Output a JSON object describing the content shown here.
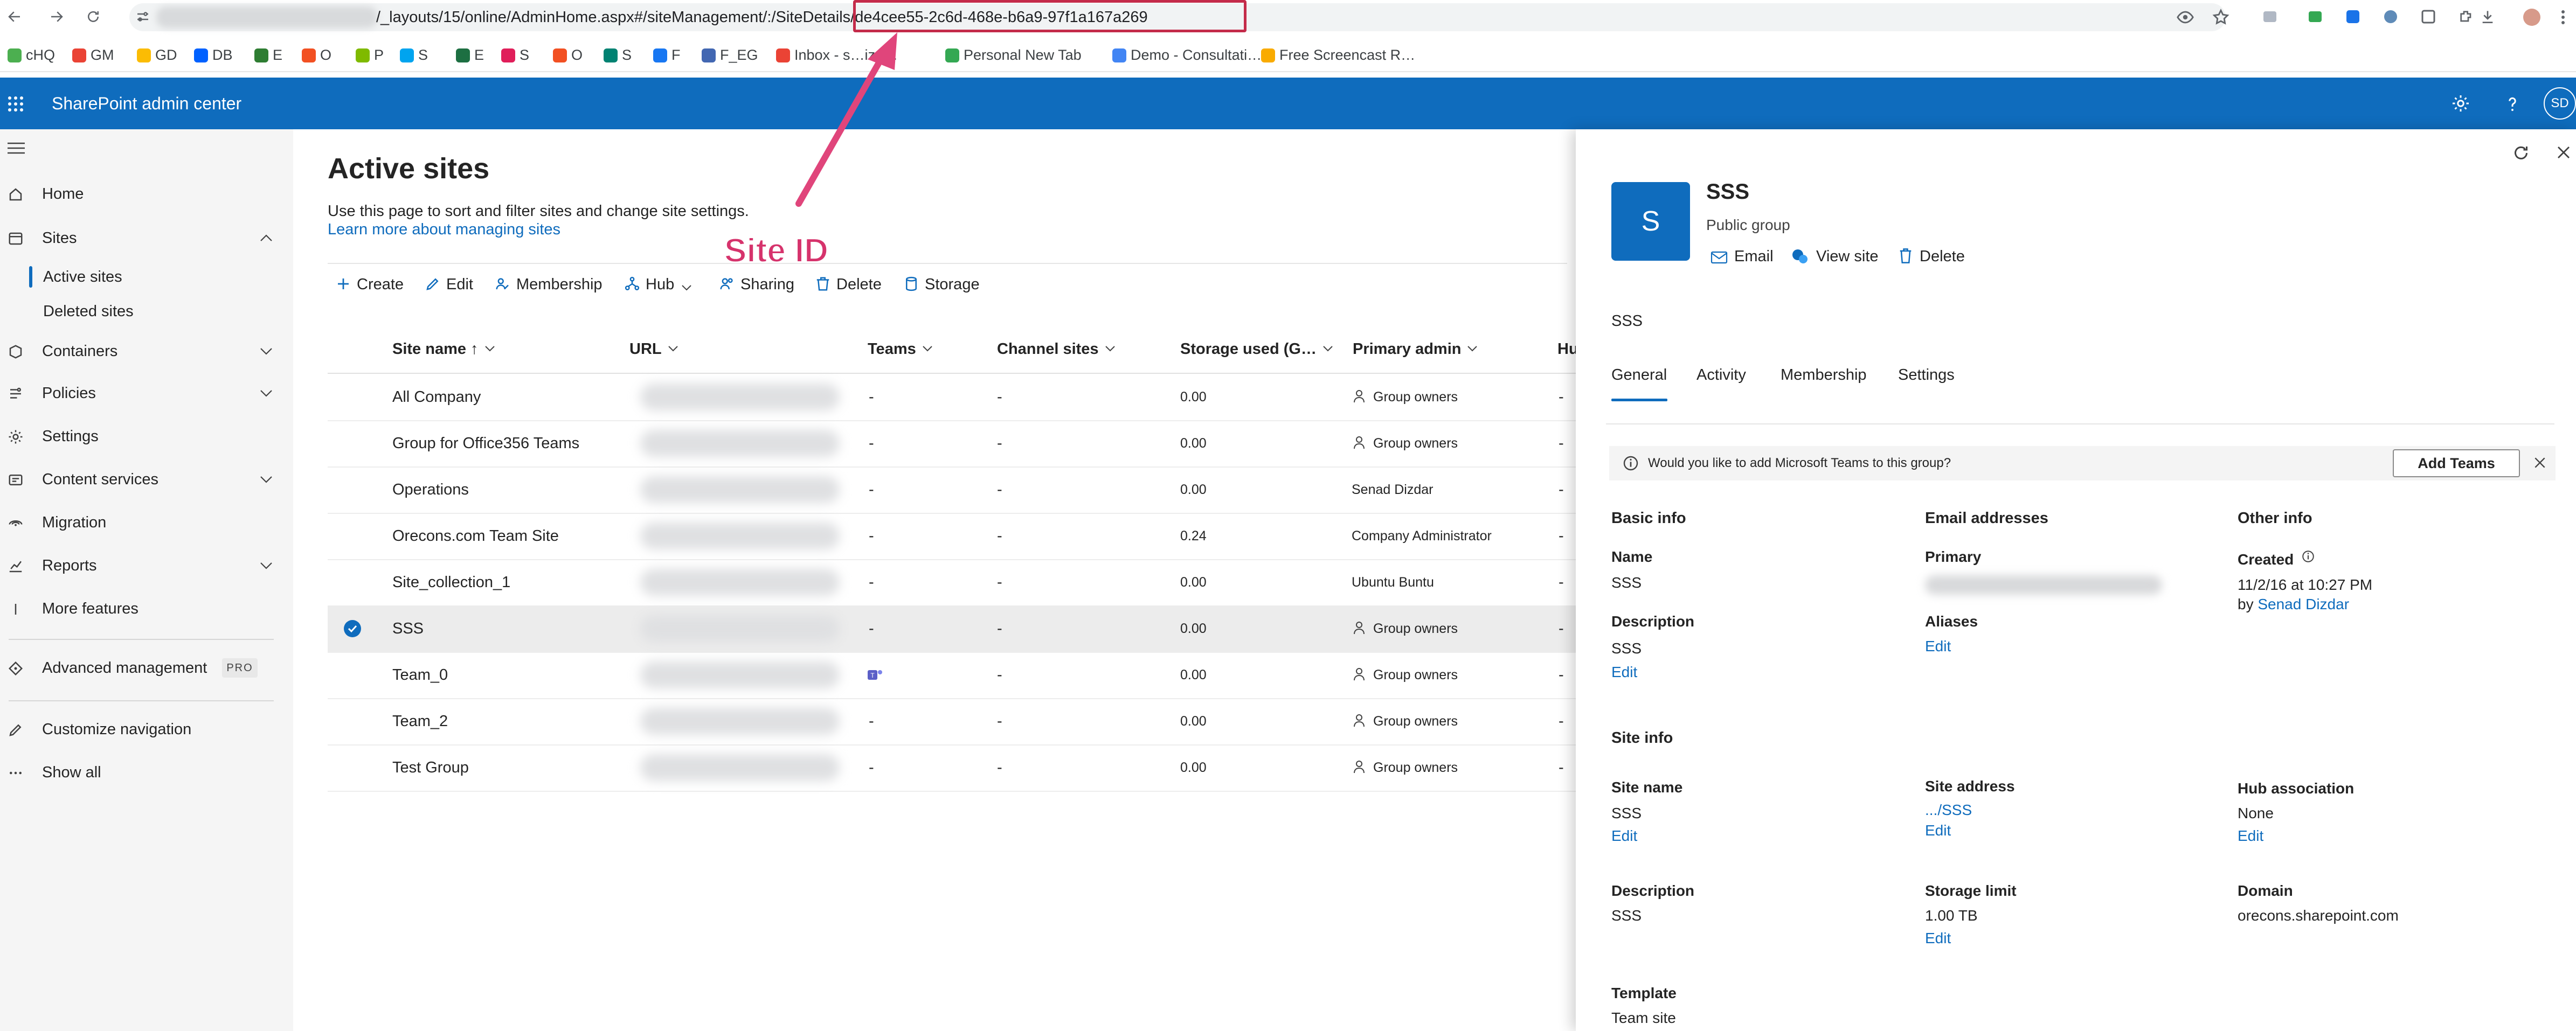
{
  "browser": {
    "url_visible": "/_layouts/15/online/AdminHome.aspx#/siteManagement/:/SiteDetails/de4cee55-2c6d-468e-b6a9-97f1a167a269",
    "bookmarks": [
      {
        "label": "cHQ",
        "color": "#4caf50"
      },
      {
        "label": "GM",
        "color": "#ea4335"
      },
      {
        "label": "GD",
        "color": "#fbbc04"
      },
      {
        "label": "DB",
        "color": "#0061ff"
      },
      {
        "label": "E",
        "color": "#2e7d32"
      },
      {
        "label": "O",
        "color": "#f25022"
      },
      {
        "label": "P",
        "color": "#7fba00"
      },
      {
        "label": "S",
        "color": "#00a4ef"
      },
      {
        "label": "E",
        "color": "#1d6f42"
      },
      {
        "label": "S",
        "color": "#e01e5a"
      },
      {
        "label": "O",
        "color": "#f25022"
      },
      {
        "label": "S",
        "color": "#008272"
      },
      {
        "label": "F",
        "color": "#1877f2"
      },
      {
        "label": "F_EG",
        "color": "#4267b2"
      },
      {
        "label": "Inbox - s…izd…",
        "color": "#ea4335"
      },
      {
        "label": "Personal New Tab",
        "color": "#34a853"
      },
      {
        "label": "Demo - Consultati…",
        "color": "#4285f4"
      },
      {
        "label": "Free Screencast R…",
        "color": "#f9ab00"
      }
    ]
  },
  "suite": {
    "title": "SharePoint admin center",
    "avatar": "SD"
  },
  "nav": {
    "items": [
      {
        "label": "Home",
        "icon": "home-icon"
      },
      {
        "label": "Sites",
        "icon": "sites-icon"
      },
      {
        "label": "Containers",
        "icon": "containers-icon"
      },
      {
        "label": "Policies",
        "icon": "policies-icon"
      },
      {
        "label": "Settings",
        "icon": "gear-icon"
      },
      {
        "label": "Content services",
        "icon": "content-services-icon"
      },
      {
        "label": "Migration",
        "icon": "migration-icon"
      },
      {
        "label": "Reports",
        "icon": "reports-icon"
      },
      {
        "label": "More features",
        "icon": "more-features-icon"
      },
      {
        "label": "Advanced management",
        "icon": "advanced-management-icon"
      },
      {
        "label": "Customize navigation",
        "icon": "pencil-icon"
      },
      {
        "label": "Show all",
        "icon": "ellipsis-icon"
      }
    ],
    "sites_sub": [
      "Active sites",
      "Deleted sites"
    ],
    "pro_badge": "PRO",
    "accent": "#0f6cbd"
  },
  "main": {
    "title": "Active sites",
    "description": "Use this page to sort and filter sites and change site settings.",
    "learn_link": "Learn more about managing sites",
    "annotation": "Site ID",
    "toolbar": [
      "Create",
      "Edit",
      "Membership",
      "Hub",
      "Sharing",
      "Delete",
      "Storage"
    ],
    "columns": [
      "Site name ↑",
      "URL",
      "Teams",
      "Channel sites",
      "Storage used (G…",
      "Primary admin",
      "Hu"
    ],
    "rows": [
      {
        "name": "All Company",
        "teams": "-",
        "channel": "-",
        "storage": "0.00",
        "admin": "Group owners",
        "admin_icon": true,
        "hub": "-",
        "selected": false
      },
      {
        "name": "Group for Office356 Teams",
        "teams": "-",
        "channel": "-",
        "storage": "0.00",
        "admin": "Group owners",
        "admin_icon": true,
        "hub": "-",
        "selected": false
      },
      {
        "name": "Operations",
        "teams": "-",
        "channel": "-",
        "storage": "0.00",
        "admin": "Senad Dizdar",
        "admin_icon": false,
        "hub": "-",
        "selected": false
      },
      {
        "name": "Orecons.com Team Site",
        "teams": "-",
        "channel": "-",
        "storage": "0.24",
        "admin": "Company Administrator",
        "admin_icon": false,
        "hub": "-",
        "selected": false
      },
      {
        "name": "Site_collection_1",
        "teams": "-",
        "channel": "-",
        "storage": "0.00",
        "admin": "Ubuntu Buntu",
        "admin_icon": false,
        "hub": "-",
        "selected": false
      },
      {
        "name": "SSS",
        "teams": "-",
        "channel": "-",
        "storage": "0.00",
        "admin": "Group owners",
        "admin_icon": true,
        "hub": "-",
        "selected": true
      },
      {
        "name": "Team_0",
        "teams": "teams-icon",
        "channel": "-",
        "storage": "0.00",
        "admin": "Group owners",
        "admin_icon": true,
        "hub": "-",
        "selected": false
      },
      {
        "name": "Team_2",
        "teams": "-",
        "channel": "-",
        "storage": "0.00",
        "admin": "Group owners",
        "admin_icon": true,
        "hub": "-",
        "selected": false
      },
      {
        "name": "Test Group",
        "teams": "-",
        "channel": "-",
        "storage": "0.00",
        "admin": "Group owners",
        "admin_icon": true,
        "hub": "-",
        "selected": false
      }
    ]
  },
  "panel": {
    "tile_letter": "S",
    "title": "SSS",
    "subtitle": "Public group",
    "actions": [
      "Email",
      "View site",
      "Delete"
    ],
    "site_name_line": "SSS",
    "tabs": [
      "General",
      "Activity",
      "Membership",
      "Settings"
    ],
    "message": "Would you like to add Microsoft Teams to this group?",
    "add_teams": "Add Teams",
    "basic_info": {
      "heading": "Basic info",
      "name_label": "Name",
      "name_value": "SSS",
      "desc_label": "Description",
      "desc_value": "SSS",
      "edit": "Edit"
    },
    "email": {
      "heading": "Email addresses",
      "primary_label": "Primary",
      "aliases_label": "Aliases",
      "edit": "Edit"
    },
    "other": {
      "heading": "Other info",
      "created_label": "Created",
      "created_value": "11/2/16 at 10:27 PM",
      "by": "by",
      "by_name": "Senad Dizdar"
    },
    "site_info": {
      "heading": "Site info",
      "site_name_label": "Site name",
      "site_name_value": "SSS",
      "site_name_edit": "Edit",
      "site_address_label": "Site address",
      "site_address_value": ".../SSS",
      "site_address_edit": "Edit",
      "hub_label": "Hub association",
      "hub_value": "None",
      "hub_edit": "Edit",
      "desc_label": "Description",
      "desc_value": "SSS",
      "storage_label": "Storage limit",
      "storage_value": "1.00 TB",
      "storage_edit": "Edit",
      "domain_label": "Domain",
      "domain_value": "orecons.sharepoint.com",
      "template_label": "Template",
      "template_value": "Team site"
    }
  }
}
